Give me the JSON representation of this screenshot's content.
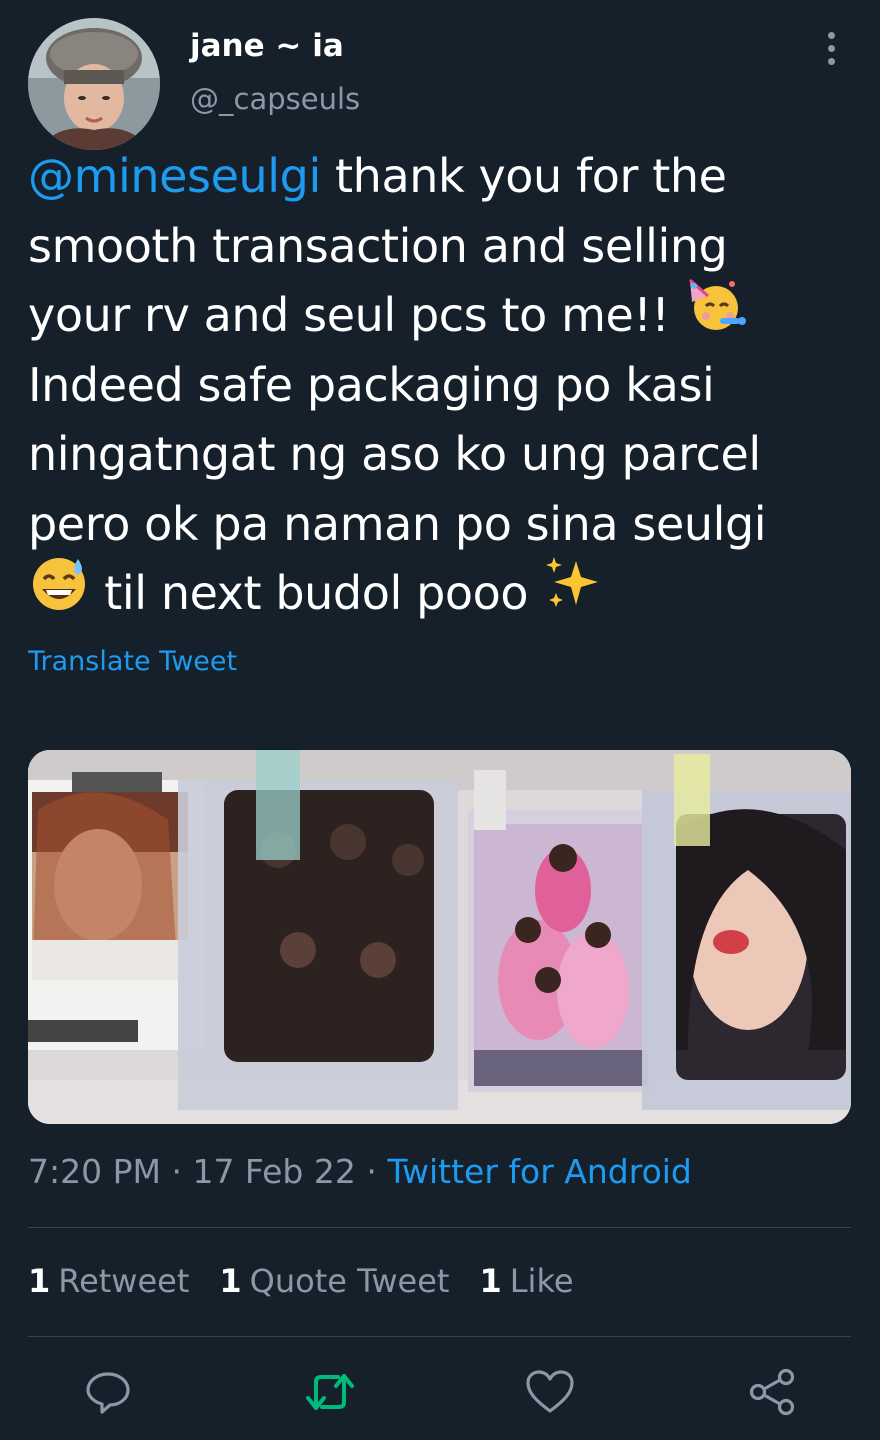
{
  "author": {
    "name": "jane ~ ia",
    "handle": "@_capseuls"
  },
  "tweet": {
    "lines": [
      {
        "mention": "@mineseulgi",
        "text": " thank you for the"
      },
      {
        "text": "smooth transaction and selling"
      },
      {
        "text": "your rv and seul pcs to me!! "
      },
      {
        "text": "Indeed safe packaging po kasi"
      },
      {
        "text": "ningatngat ng aso ko ung parcel"
      },
      {
        "text": "pero ok pa naman po sina seulgi"
      },
      {
        "text": " til next budol pooo "
      }
    ],
    "emojis": [
      "partying-face-emoji",
      "sweat-smile-emoji",
      "sparkles-emoji"
    ],
    "translate_label": "Translate Tweet"
  },
  "meta": {
    "time": "7:20 PM",
    "sep1": " · ",
    "date": "17 Feb 22",
    "sep2": " · ",
    "source": "Twitter for Android"
  },
  "stats": {
    "retweets": {
      "count": "1",
      "label": "Retweet"
    },
    "quotes": {
      "count": "1",
      "label": "Quote Tweet"
    },
    "likes": {
      "count": "1",
      "label": "Like"
    }
  },
  "actions": [
    "reply-icon",
    "retweet-icon",
    "like-icon",
    "share-icon"
  ],
  "colors": {
    "background": "#15202b",
    "link": "#1d9bf0",
    "secondary_text": "#8b98a5",
    "retweet_active": "#00ba7c",
    "divider": "#38444d"
  }
}
